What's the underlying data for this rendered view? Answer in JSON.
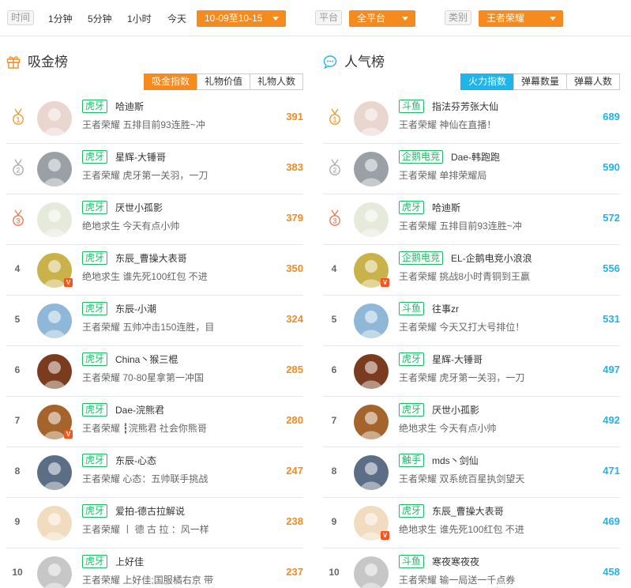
{
  "filters": {
    "time_label": "时间",
    "time_options": [
      "1分钟",
      "5分钟",
      "1小时",
      "今天"
    ],
    "date_range": "10-09至10-15",
    "platform_label": "平台",
    "platform_value": "全平台",
    "category_label": "类别",
    "category_value": "王者荣耀"
  },
  "left_panel": {
    "title": "吸金榜",
    "icon": "gift-icon",
    "accent": "#f58a1f",
    "tabs": [
      "吸金指数",
      "礼物价值",
      "礼物人数"
    ],
    "active_tab": 0,
    "rows": [
      {
        "rank": "1",
        "platform": "虎牙",
        "name": "哈迪斯",
        "category": "王者荣耀",
        "desc": "五排目前93连胜~冲",
        "score": "391",
        "verified": false
      },
      {
        "rank": "2",
        "platform": "虎牙",
        "name": "星辉-大锤哥",
        "category": "王者荣耀",
        "desc": "虎牙第一关羽，一刀",
        "score": "383",
        "verified": false
      },
      {
        "rank": "3",
        "platform": "虎牙",
        "name": "厌世小孤影",
        "category": "绝地求生",
        "desc": "今天有点小帅",
        "score": "379",
        "verified": false
      },
      {
        "rank": "4",
        "platform": "虎牙",
        "name": "东辰_曹操大表哥",
        "category": "绝地求生",
        "desc": "谁先死100红包 不进",
        "score": "350",
        "verified": true
      },
      {
        "rank": "5",
        "platform": "虎牙",
        "name": "东辰-小潮",
        "category": "王者荣耀",
        "desc": "五帅冲击150连胜，目",
        "score": "324",
        "verified": false
      },
      {
        "rank": "6",
        "platform": "虎牙",
        "name": "China丶猴三棍",
        "category": "王者荣耀",
        "desc": "70-80星拿第一冲国",
        "score": "285",
        "verified": false
      },
      {
        "rank": "7",
        "platform": "虎牙",
        "name": "Dae-浣熊君",
        "category": "王者荣耀",
        "desc": "┇浣熊君 社会你熊哥",
        "score": "280",
        "verified": true
      },
      {
        "rank": "8",
        "platform": "虎牙",
        "name": "东辰-心态",
        "category": "王者荣耀",
        "desc": "心态：五帅联手挑战",
        "score": "247",
        "verified": false
      },
      {
        "rank": "9",
        "platform": "虎牙",
        "name": "爱拍-德古拉解说",
        "category": "王者荣耀",
        "desc": "丨 德 古 拉 ：风一样",
        "score": "238",
        "verified": false
      },
      {
        "rank": "10",
        "platform": "虎牙",
        "name": "上好佳",
        "category": "王者荣耀",
        "desc": "上好佳;国服橘右京 带",
        "score": "237",
        "verified": false
      }
    ]
  },
  "right_panel": {
    "title": "人气榜",
    "icon": "chat-bubble-icon",
    "accent": "#1fb4ea",
    "tabs": [
      "火力指数",
      "弹幕数量",
      "弹幕人数"
    ],
    "active_tab": 0,
    "rows": [
      {
        "rank": "1",
        "platform": "斗鱼",
        "name": "指法芬芳张大仙",
        "category": "王者荣耀",
        "desc": "神仙在直播！",
        "score": "689",
        "verified": false
      },
      {
        "rank": "2",
        "platform": "企鹅电竞",
        "name": "Dae-韩跑跑",
        "category": "王者荣耀",
        "desc": "单排荣耀局",
        "score": "590",
        "verified": false
      },
      {
        "rank": "3",
        "platform": "虎牙",
        "name": "哈迪斯",
        "category": "王者荣耀",
        "desc": "五排目前93连胜~冲",
        "score": "572",
        "verified": false
      },
      {
        "rank": "4",
        "platform": "企鹅电竞",
        "name": "EL-企鹅电竞小浪浪",
        "category": "王者荣耀",
        "desc": "挑战8小时青铜到王赢",
        "score": "556",
        "verified": true
      },
      {
        "rank": "5",
        "platform": "斗鱼",
        "name": "往事zr",
        "category": "王者荣耀",
        "desc": "今天又打大号排位！",
        "score": "531",
        "verified": false
      },
      {
        "rank": "6",
        "platform": "虎牙",
        "name": "星辉-大锤哥",
        "category": "王者荣耀",
        "desc": "虎牙第一关羽，一刀",
        "score": "497",
        "verified": false
      },
      {
        "rank": "7",
        "platform": "虎牙",
        "name": "厌世小孤影",
        "category": "绝地求生",
        "desc": "今天有点小帅",
        "score": "492",
        "verified": false
      },
      {
        "rank": "8",
        "platform": "触手",
        "name": "mds丶剑仙",
        "category": "王者荣耀",
        "desc": "双系统百星执剑望天",
        "score": "471",
        "verified": false
      },
      {
        "rank": "9",
        "platform": "虎牙",
        "name": "东辰_曹操大表哥",
        "category": "绝地求生",
        "desc": "谁先死100红包 不进",
        "score": "469",
        "verified": true
      },
      {
        "rank": "10",
        "platform": "斗鱼",
        "name": "寒夜寒夜夜",
        "category": "王者荣耀",
        "desc": "输一局送一千点券",
        "score": "458",
        "verified": false
      }
    ]
  }
}
